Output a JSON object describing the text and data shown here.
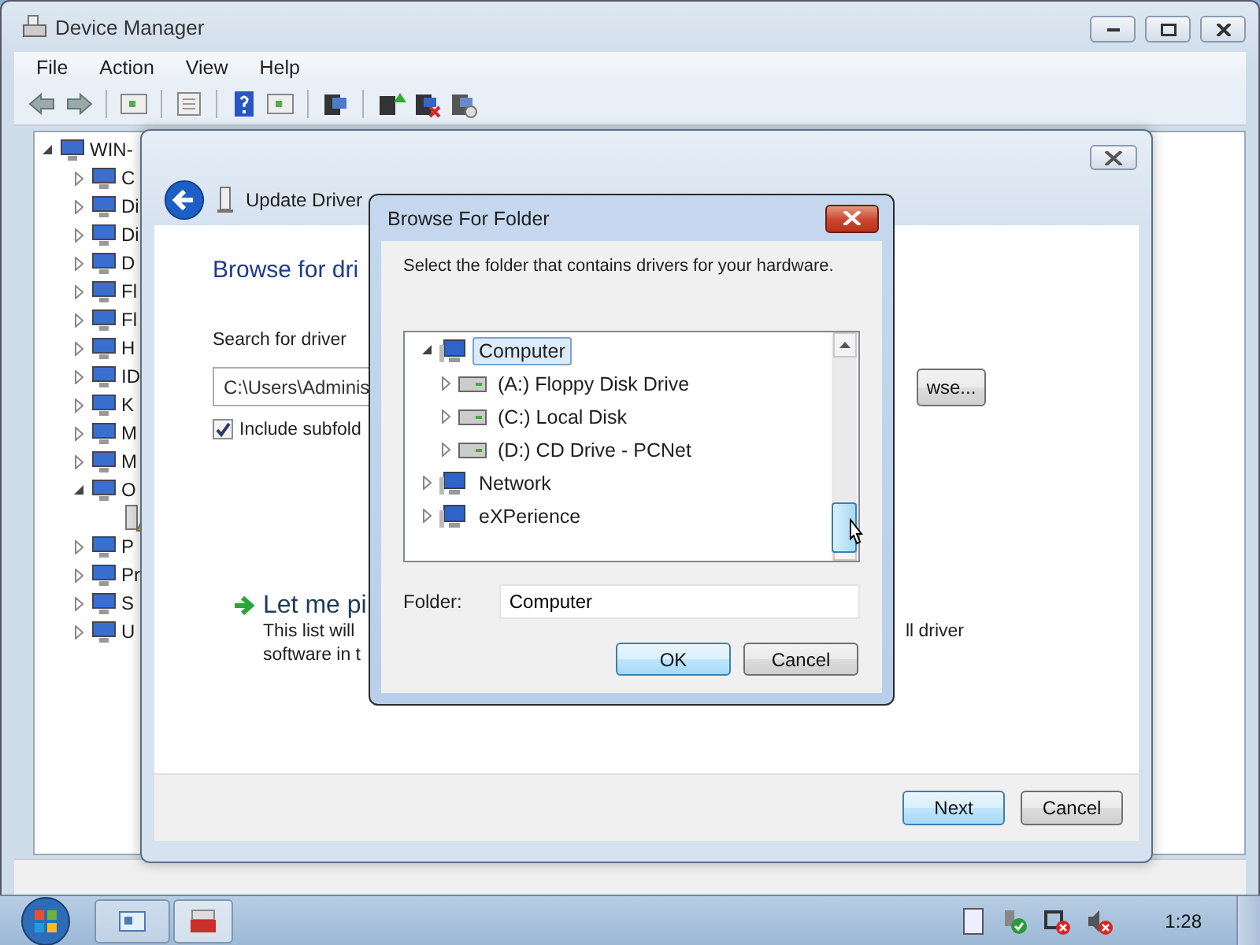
{
  "device_manager": {
    "title": "Device Manager",
    "menu": [
      "File",
      "Action",
      "View",
      "Help"
    ],
    "tree": {
      "label": "WIN-",
      "expanded": true,
      "children": [
        {
          "label": "C",
          "expanded": false
        },
        {
          "label": "Di",
          "expanded": false
        },
        {
          "label": "Di",
          "expanded": false
        },
        {
          "label": "D",
          "expanded": false
        },
        {
          "label": "Fl",
          "expanded": false
        },
        {
          "label": "Fl",
          "expanded": false
        },
        {
          "label": "H",
          "expanded": false
        },
        {
          "label": "ID",
          "expanded": false
        },
        {
          "label": "K",
          "expanded": false
        },
        {
          "label": "M",
          "expanded": false
        },
        {
          "label": "M",
          "expanded": false
        },
        {
          "label": "O",
          "expanded": true,
          "children": [
            {
              "warning": true
            }
          ]
        },
        {
          "label": "P",
          "expanded": false
        },
        {
          "label": "Pr",
          "expanded": false
        },
        {
          "label": "S",
          "expanded": false
        },
        {
          "label": "U",
          "expanded": false
        }
      ]
    }
  },
  "wizard": {
    "title": "Update Driver",
    "heading": "Browse for dri",
    "search_label": "Search for driver",
    "path_field": {
      "value": "C:\\Users\\Adminis"
    },
    "include_subfolders": {
      "label": "Include subfold",
      "checked": true
    },
    "browse_button": "wse...",
    "pick_option": {
      "title": "Let me pi",
      "description": [
        "This list will",
        "software in t"
      ],
      "description_tail": "ll driver"
    },
    "buttons": [
      {
        "label": "Next",
        "default": true
      },
      {
        "label": "Cancel",
        "default": false
      }
    ]
  },
  "browse_dialog": {
    "title": "Browse For Folder",
    "prompt": "Select the folder that contains drivers for your hardware.",
    "tree": [
      {
        "label": "Computer",
        "expanded": true,
        "selected": true,
        "children": [
          {
            "label": "(A:) Floppy Disk Drive",
            "expanded": false,
            "selected": false
          },
          {
            "label": "(C:) Local Disk",
            "expanded": false,
            "selected": false
          },
          {
            "label": "(D:) CD Drive - PCNet",
            "expanded": false,
            "selected": false
          }
        ]
      },
      {
        "label": "Network",
        "expanded": false,
        "selected": false
      },
      {
        "label": "eXPerience",
        "expanded": false,
        "selected": false
      }
    ],
    "folder_label": "Folder:",
    "folder_field": {
      "value": "Computer"
    },
    "buttons": [
      {
        "label": "OK",
        "default": true
      },
      {
        "label": "Cancel",
        "default": false
      }
    ]
  },
  "taskbar": {
    "clock": "1:28"
  }
}
